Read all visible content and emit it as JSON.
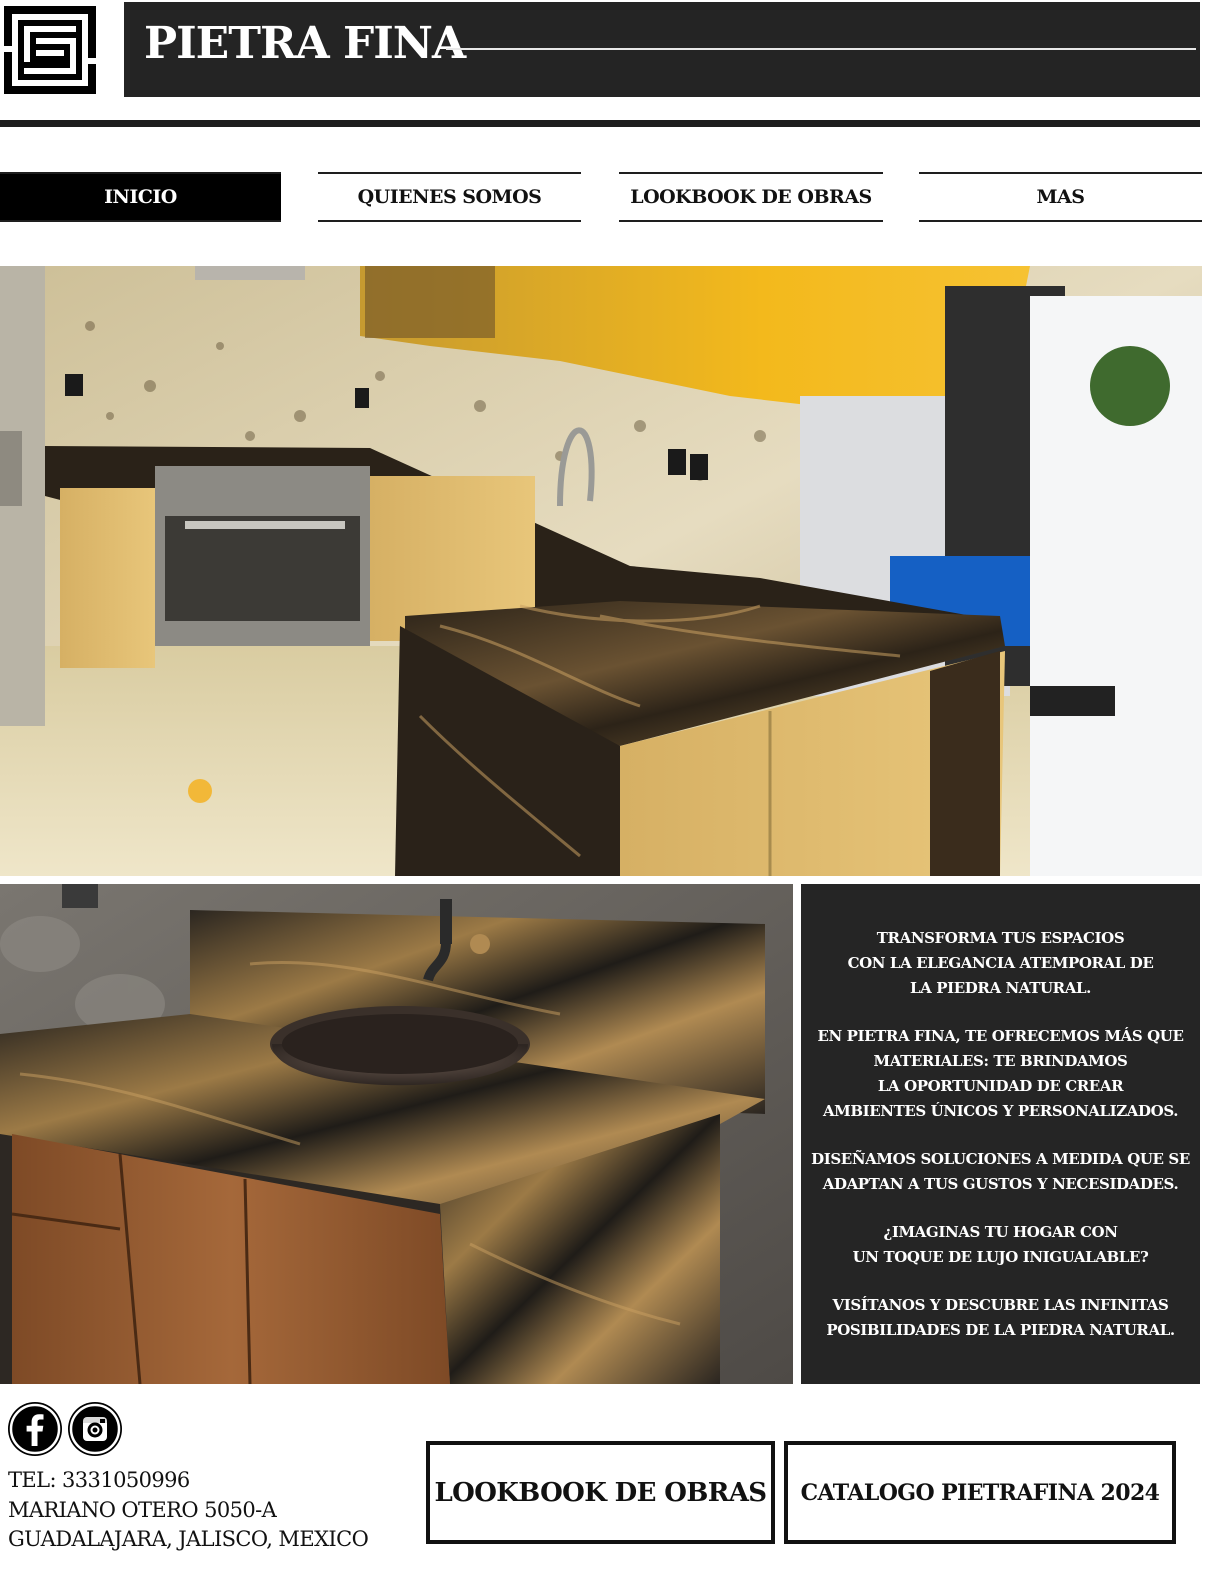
{
  "header": {
    "logo_icon": "maze-square-logo",
    "title": "PIETRA FINA"
  },
  "nav": {
    "items": [
      {
        "label": "INICIO",
        "active": true
      },
      {
        "label": "QUIENES SOMOS",
        "active": false
      },
      {
        "label": "LOOKBOOK DE OBRAS",
        "active": false
      },
      {
        "label": "MAS",
        "active": false
      }
    ]
  },
  "hero": {
    "image": "kitchen-granite-countertop-photo"
  },
  "vanity": {
    "image": "granite-bathroom-vanity-photo"
  },
  "panel": {
    "paragraphs": [
      [
        "TRANSFORMA TUS ESPACIOS",
        "CON LA ELEGANCIA ATEMPORAL DE",
        "LA PIEDRA NATURAL."
      ],
      [
        "EN PIETRA FINA, TE OFRECEMOS MÁS QUE",
        "MATERIALES: TE BRINDAMOS",
        "LA OPORTUNIDAD DE CREAR",
        "AMBIENTES ÚNICOS Y PERSONALIZADOS."
      ],
      [
        "DISEÑAMOS SOLUCIONES A MEDIDA QUE SE",
        "ADAPTAN A TUS GUSTOS Y NECESIDADES."
      ],
      [
        "¿IMAGINAS TU HOGAR CON",
        "UN TOQUE DE LUJO INIGUALABLE?"
      ],
      [
        "VISÍTANOS Y DESCUBRE LAS INFINITAS",
        "POSIBILIDADES DE LA PIEDRA NATURAL."
      ]
    ]
  },
  "footer": {
    "social": [
      {
        "icon": "facebook-icon"
      },
      {
        "icon": "instagram-icon"
      }
    ],
    "contact": {
      "phone": "TEL: 3331050996",
      "address_line1": "MARIANO OTERO 5050-A",
      "address_line2": "GUADALAJARA, JALISCO, MEXICO"
    },
    "buttons": {
      "lookbook": "LOOKBOOK DE OBRAS",
      "catalog": "CATALOGO PIETRAFINA 2024"
    }
  },
  "colors": {
    "dark": "#242424",
    "black": "#000000",
    "white": "#ffffff"
  }
}
